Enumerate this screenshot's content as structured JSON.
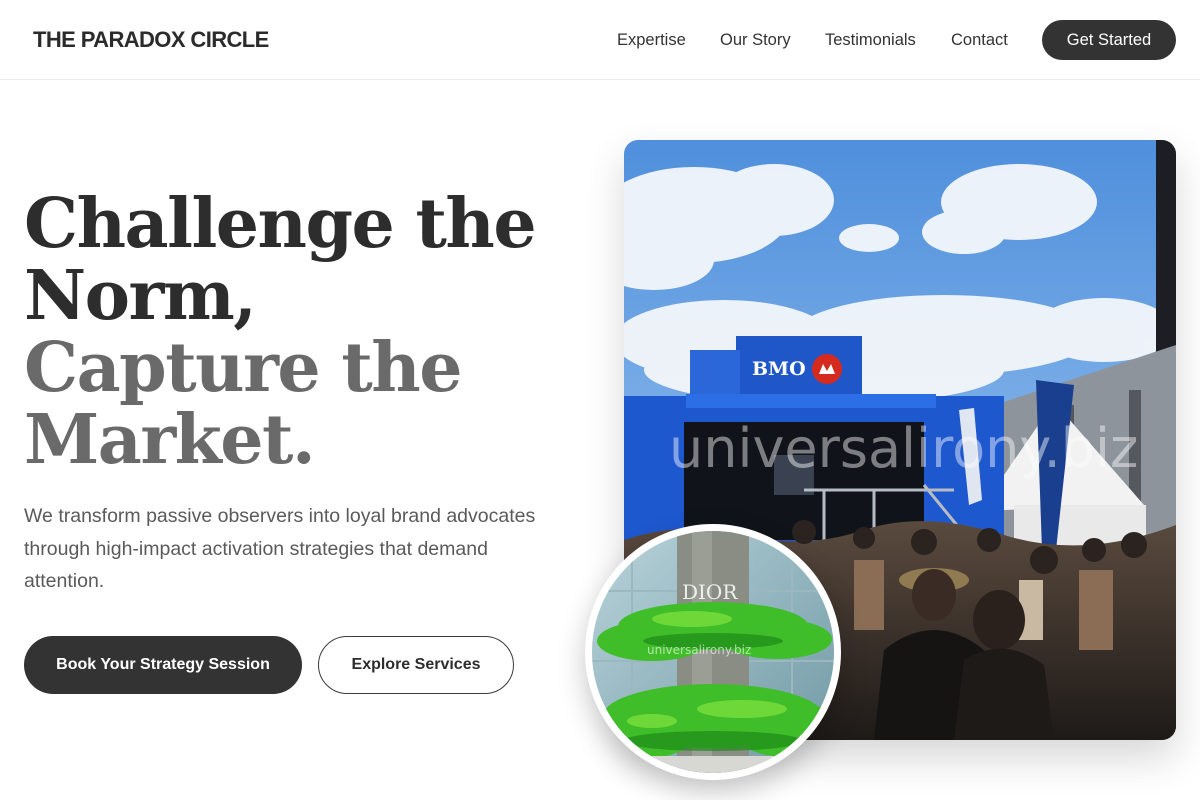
{
  "brand": {
    "name": "THE PARADOX CIRCLE"
  },
  "nav": {
    "items": [
      {
        "label": "Expertise"
      },
      {
        "label": "Our Story"
      },
      {
        "label": "Testimonials"
      },
      {
        "label": "Contact"
      }
    ],
    "cta_label": "Get Started"
  },
  "hero": {
    "headline_lines": [
      "Challenge the",
      "Norm,",
      "Capture the",
      "Market."
    ],
    "description": "We transform passive observers into loyal brand advocates through high-impact activation strategies that demand attention.",
    "primary_button": "Book Your Strategy Session",
    "secondary_button": "Explore Services"
  },
  "hero_image": {
    "truck_sign": "BMO",
    "watermark": "universalirony.biz"
  },
  "round_image": {
    "sign": "DIOR",
    "watermark": "universalirony.biz"
  },
  "colors": {
    "primary_dark": "#333333",
    "headline_dark": "#2d2d2d",
    "headline_grey": "#6a6a6a",
    "body_text": "#5a5a5a",
    "truck_blue": "#1f56c8",
    "moss_green": "#3fbe2a"
  }
}
